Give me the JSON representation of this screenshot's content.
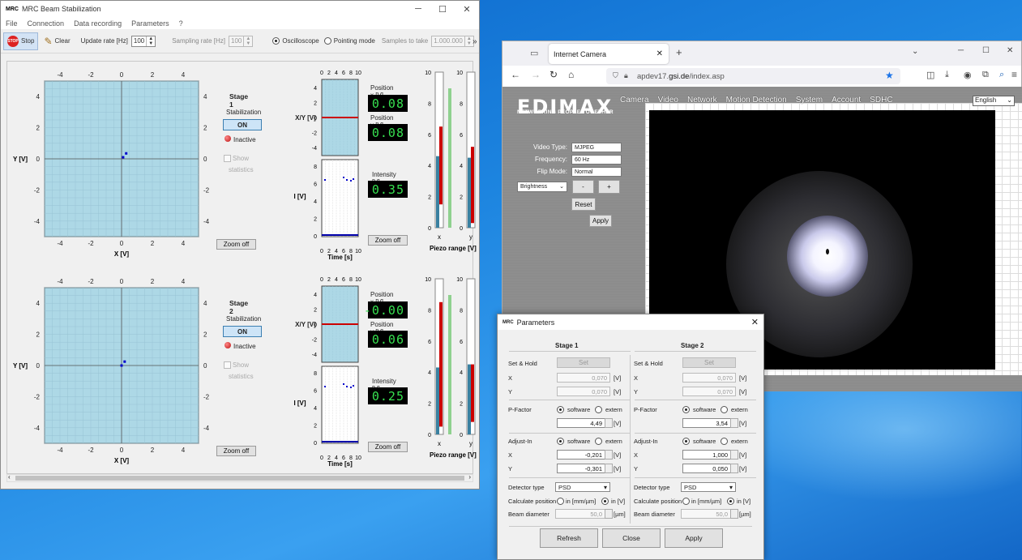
{
  "mrc": {
    "title": "MRC Beam Stabilization",
    "menu": [
      "File",
      "Connection",
      "Data recording",
      "Parameters",
      "?"
    ],
    "toolbar": {
      "stop": "Stop",
      "clear": "Clear",
      "update_rate_label": "Update rate [Hz]",
      "update_rate": "100",
      "sampling_rate_label": "Sampling rate [Hz]",
      "sampling_rate": "100",
      "oscilloscope": "Oscilloscope",
      "pointing_mode": "Pointing mode",
      "samples_label": "Samples to take",
      "samples": "1.000.000",
      "more": "»"
    },
    "stages": [
      {
        "title": "Stage 1",
        "stabilization_label": "Stabilization",
        "on": "ON",
        "status": "Inactive",
        "show": "Show",
        "statistics": "statistics",
        "zoom": "Zoom off",
        "pos_x_label": "Position x [V]",
        "pos_x": "0.08",
        "pos_y_label": "Position y [V]",
        "pos_y": "0.08",
        "intensity_label": "Intensity [V]",
        "intensity": "0.35",
        "zoom2": "Zoom off",
        "piezo_label": "Piezo range [V]",
        "piezo_x": 0.46,
        "piezo_y": 0.45,
        "piezo_x_range": [
          0.15,
          0.65
        ],
        "piezo_y_range": [
          0.03,
          0.52
        ],
        "beam": [
          0.1,
          0.1
        ]
      },
      {
        "title": "Stage 2",
        "stabilization_label": "Stabilization",
        "on": "ON",
        "status": "Inactive",
        "show": "Show",
        "statistics": "statistics",
        "zoom": "Zoom off",
        "pos_x_label": "Position x [V]",
        "pos_x": "-0.00",
        "pos_y_label": "Position y [V]",
        "pos_y": "0.06",
        "intensity_label": "Intensity [V]",
        "intensity": "0.25",
        "zoom2": "Zoom off",
        "piezo_label": "Piezo range [V]",
        "piezo_x": 0.43,
        "piezo_y": 0.45,
        "piezo_x_range": [
          0.05,
          0.85
        ],
        "piezo_y_range": [
          0.08,
          0.45
        ],
        "beam": [
          0.0,
          0.0
        ]
      }
    ],
    "xy_axis": {
      "xlabel": "X [V]",
      "ylabel": "Y [V]",
      "ticks": [
        "-4",
        "-2",
        "0",
        "2",
        "4"
      ]
    },
    "scope": {
      "time_label": "Time [s]",
      "xy_label": "X/Y [V]",
      "i_label": "I [V]",
      "time_ticks": [
        "0",
        "2",
        "4",
        "6",
        "8",
        "10"
      ],
      "xy_ticks": [
        "4",
        "2",
        "0",
        "-2",
        "-4"
      ],
      "i_ticks": [
        "8",
        "6",
        "4",
        "2",
        "0"
      ]
    },
    "piezo_ticks": [
      "10",
      "8",
      "6",
      "4",
      "2",
      "0"
    ],
    "piezo_axes": [
      "x",
      "y"
    ]
  },
  "browser": {
    "tab_title": "Internet Camera",
    "url_prefix": "apdev17.",
    "url_domain": "gsi.de",
    "url_path": "/index.asp",
    "brand": "EDIMAX",
    "tagline": "NETWORKING PEOPLE TOGETHER",
    "nav": [
      "Camera",
      "Video",
      "Network",
      "Motion Detection",
      "System",
      "Account",
      "SDHC"
    ],
    "language": "English",
    "video_type_label": "Video Type:",
    "video_type": "MJPEG",
    "frequency_label": "Frequency:",
    "frequency": "60 Hz",
    "flip_label": "Flip Mode:",
    "flip": "Normal",
    "brightness": "Brightness",
    "minus": "-",
    "plus": "+",
    "reset": "Reset",
    "apply": "Apply"
  },
  "params": {
    "title": "Parameters",
    "stage1": {
      "title": "Stage 1",
      "set_hold": "Set & Hold",
      "set": "Set",
      "x": "0,070",
      "y": "0,070",
      "pfactor": "4,49",
      "adj_x": "-0,201",
      "adj_y": "-0,301",
      "detector": "PSD",
      "beam_diameter": "50,0"
    },
    "stage2": {
      "title": "Stage 2",
      "set_hold": "Set & Hold",
      "set": "Set",
      "x": "0,070",
      "y": "0,070",
      "pfactor": "3,54",
      "adj_x": "1,000",
      "adj_y": "0,050",
      "detector": "PSD",
      "beam_diameter": "50,0"
    },
    "labels": {
      "x": "X",
      "y": "Y",
      "unit_v": "[V]",
      "unit_um": "[µm]",
      "pfactor": "P-Factor",
      "software": "software",
      "extern": "extern",
      "adjust_in": "Adjust-In",
      "detector_type": "Detector type",
      "calc_pos": "Calculate position",
      "in_mm": "in [mm/µm]",
      "in_v": "in [V]",
      "beam_diameter": "Beam diameter"
    },
    "buttons": {
      "refresh": "Refresh",
      "close": "Close",
      "apply": "Apply"
    }
  }
}
